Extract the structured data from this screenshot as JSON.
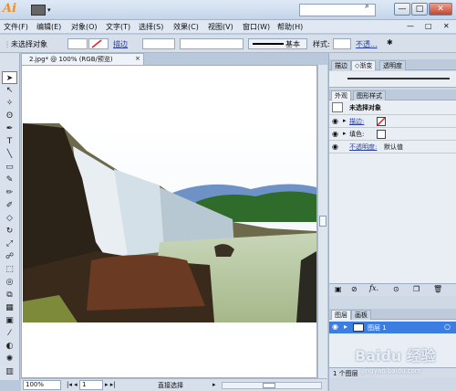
{
  "app": {
    "logo": "Ai",
    "search_placeholder": ""
  },
  "window_buttons": {
    "min": "—",
    "max": "□",
    "close": "✕"
  },
  "doc_buttons": {
    "min": "—",
    "max": "□",
    "close": "✕"
  },
  "menu": [
    "文件(F)",
    "编辑(E)",
    "对象(O)",
    "文字(T)",
    "选择(S)",
    "效果(C)",
    "视图(V)",
    "窗口(W)",
    "帮助(H)"
  ],
  "control_bar": {
    "selection_status": "未选择对象",
    "stroke_label": "描边",
    "style_preset": "基本",
    "style_label": "样式:",
    "opacity_link": "不透..."
  },
  "document": {
    "tab_label": "2.jpg* @ 100% (RGB/预览)",
    "tab_close": "×"
  },
  "status": {
    "zoom": "100%",
    "page": "1",
    "tool": "直接选择"
  },
  "gradient_panel": {
    "tabs": [
      "描边",
      "◇渐变",
      "透明度"
    ]
  },
  "appearance_panel": {
    "tabs": [
      "外观",
      "图形样式"
    ],
    "header": "未选择对象",
    "rows": [
      {
        "label": "描边:",
        "linked": true
      },
      {
        "label": "填色:",
        "linked": false
      },
      {
        "label": "不透明度:",
        "value": "默认值",
        "linked": true
      }
    ],
    "footer_icons": [
      "new-art-icon",
      "clear-icon",
      "fx-icon",
      "reduce-icon",
      "duplicate-icon",
      "delete-icon"
    ]
  },
  "layers_panel": {
    "tabs": [
      "图层",
      "画板"
    ],
    "layer_name": "图层 1",
    "layer_count": "1 个图层",
    "accent_color": "#3b7de0"
  },
  "watermark": {
    "text": "Baidu 经验",
    "sub": "jingyan.baidu.com"
  }
}
